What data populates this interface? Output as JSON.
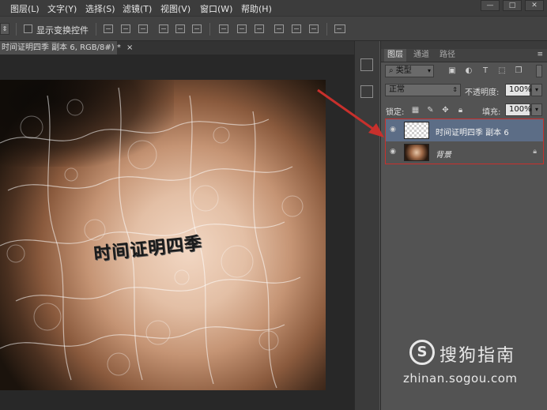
{
  "menubar": {
    "items": [
      "图层(L)",
      "文字(Y)",
      "选择(S)",
      "滤镜(T)",
      "视图(V)",
      "窗口(W)",
      "帮助(H)"
    ],
    "window_buttons": [
      "—",
      "□",
      "✕"
    ]
  },
  "optionsbar": {
    "show_transform_controls": "显示变换控件"
  },
  "document": {
    "tab_title": "时间证明四季  副本 6, RGB/8#) *",
    "tab_close": "×",
    "canvas_text": "时间证明四季"
  },
  "layers_panel": {
    "tabs": [
      "图层",
      "通道",
      "路径"
    ],
    "filter_kind": "类型",
    "blend_mode": "正常",
    "opacity_label": "不透明度:",
    "opacity_value": "100%",
    "lock_label": "锁定:",
    "fill_label": "填充:",
    "fill_value": "100%",
    "layers": [
      {
        "name": "时间证明四季  副本 6",
        "selected": true,
        "thumbnail": "transparent"
      },
      {
        "name": "背景",
        "selected": false,
        "thumbnail": "photo",
        "locked": true
      }
    ]
  },
  "watermark": {
    "logo_letter": "S",
    "brand": "搜狗指南",
    "url": "zhinan.sogou.com"
  },
  "colors": {
    "annotation_red": "#c8302c",
    "selected_layer": "#5c6d86",
    "panel_bg": "#535353"
  }
}
